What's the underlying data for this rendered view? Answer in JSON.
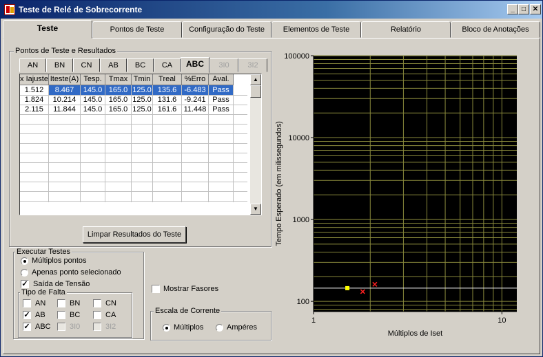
{
  "window": {
    "title": "Teste de Relé de Sobrecorrente",
    "min_glyph": "_",
    "max_glyph": "□",
    "close_glyph": "✕"
  },
  "main_tabs": [
    {
      "label": "Teste",
      "active": true
    },
    {
      "label": "Pontos de Teste",
      "active": false
    },
    {
      "label": "Configuração do Teste",
      "active": false
    },
    {
      "label": "Elementos de Teste",
      "active": false
    },
    {
      "label": "Relatório",
      "active": false
    },
    {
      "label": "Bloco de Anotações",
      "active": false
    }
  ],
  "results_group": {
    "title": "Pontos de Teste e Resultados",
    "subtabs": [
      {
        "label": "AN",
        "active": false,
        "disabled": false
      },
      {
        "label": "BN",
        "active": false,
        "disabled": false
      },
      {
        "label": "CN",
        "active": false,
        "disabled": false
      },
      {
        "label": "AB",
        "active": false,
        "disabled": false
      },
      {
        "label": "BC",
        "active": false,
        "disabled": false
      },
      {
        "label": "CA",
        "active": false,
        "disabled": false
      },
      {
        "label": "ABC",
        "active": true,
        "disabled": false
      },
      {
        "label": "3I0",
        "active": false,
        "disabled": true
      },
      {
        "label": "3I2",
        "active": false,
        "disabled": true
      }
    ],
    "columns": [
      "x Iajuste",
      "Iteste(A)",
      "Tesp.",
      "Tmax",
      "Tmin",
      "Treal",
      "%Erro",
      "Aval."
    ],
    "rows": [
      [
        "1.512",
        "8.467",
        "145.0",
        "165.0",
        "125.0",
        "135.6",
        "-6.483",
        "Pass"
      ],
      [
        "1.824",
        "10.214",
        "145.0",
        "165.0",
        "125.0",
        "131.6",
        "-9.241",
        "Pass"
      ],
      [
        "2.115",
        "11.844",
        "145.0",
        "165.0",
        "125.0",
        "161.6",
        "11.448",
        "Pass"
      ]
    ],
    "selected_row": 0,
    "clear_button": "Limpar Resultados do Teste"
  },
  "execute_group": {
    "title": "Executar Testes",
    "multi_points": "Múltiplos pontos",
    "single_point": "Apenas ponto selecionado",
    "voltage_output": "Saída de Tensão",
    "mode": "multi",
    "voltage_checked": true
  },
  "fault_group": {
    "title": "Tipo de Falta",
    "items": [
      {
        "label": "AN",
        "checked": false,
        "disabled": false
      },
      {
        "label": "BN",
        "checked": false,
        "disabled": false
      },
      {
        "label": "CN",
        "checked": false,
        "disabled": false
      },
      {
        "label": "AB",
        "checked": true,
        "disabled": false
      },
      {
        "label": "BC",
        "checked": false,
        "disabled": false
      },
      {
        "label": "CA",
        "checked": false,
        "disabled": false
      },
      {
        "label": "ABC",
        "checked": true,
        "disabled": false
      },
      {
        "label": "3I0",
        "checked": false,
        "disabled": true
      },
      {
        "label": "3I2",
        "checked": false,
        "disabled": true
      }
    ]
  },
  "phasors": {
    "label": "Mostrar Fasores",
    "checked": false
  },
  "current_scale": {
    "title": "Escala de Corrente",
    "multiples": "Múltiplos",
    "amperes": "Ampéres",
    "selected": "multiples"
  },
  "chart_data": {
    "type": "scatter",
    "title": "",
    "xlabel": "Múltiplos de Iset",
    "ylabel": "Tempo Esperado (em milissegundos)",
    "x_scale": "log",
    "y_scale": "log",
    "xlim": [
      1,
      12
    ],
    "ylim": [
      75,
      100000
    ],
    "x_ticks": [
      {
        "value": 1,
        "label": "1"
      },
      {
        "value": 10,
        "label": "10"
      }
    ],
    "y_ticks": [
      {
        "value": 100,
        "label": "100"
      },
      {
        "value": 1000,
        "label": "1000"
      },
      {
        "value": 10000,
        "label": "10000"
      },
      {
        "value": 100000,
        "label": "100000"
      }
    ],
    "background": "#000000",
    "grid_color": "#8a8a3c",
    "grid": true,
    "reference_line": {
      "y": 145,
      "color": "#ffffff"
    },
    "series": [
      {
        "marker": "square",
        "color": "#ffff00",
        "points": [
          {
            "x": 1.512,
            "y": 145
          }
        ]
      },
      {
        "marker": "x",
        "color": "#ff2020",
        "points": [
          {
            "x": 1.824,
            "y": 131.6
          },
          {
            "x": 2.115,
            "y": 161.6
          }
        ]
      }
    ]
  }
}
